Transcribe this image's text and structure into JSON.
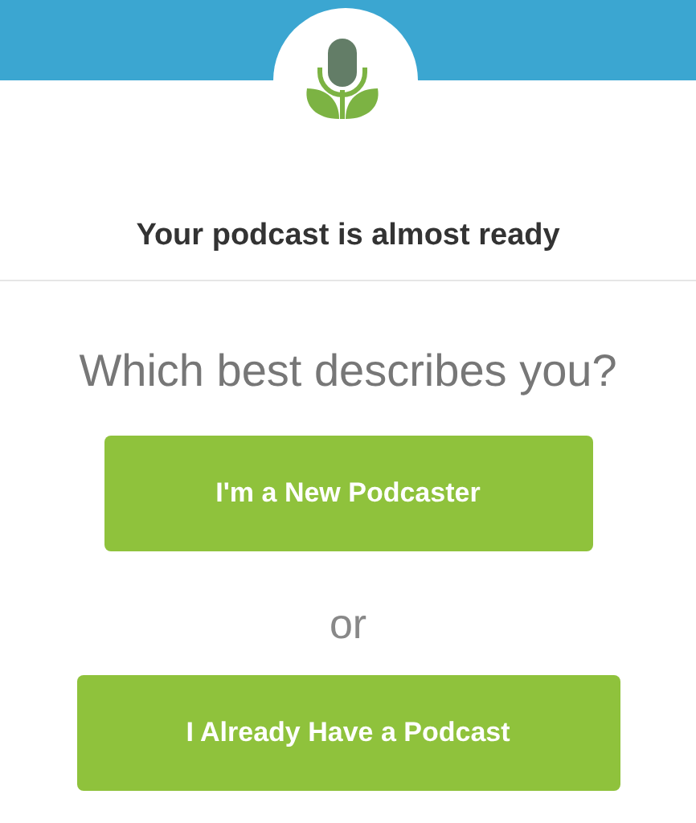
{
  "header": {
    "title": "Your podcast is almost ready"
  },
  "question": "Which best describes you?",
  "choices": [
    {
      "label": "I'm a New Podcaster",
      "kind": "narrow"
    },
    {
      "label": "I Already Have a Podcast",
      "kind": "wide"
    }
  ],
  "separator": "or"
}
